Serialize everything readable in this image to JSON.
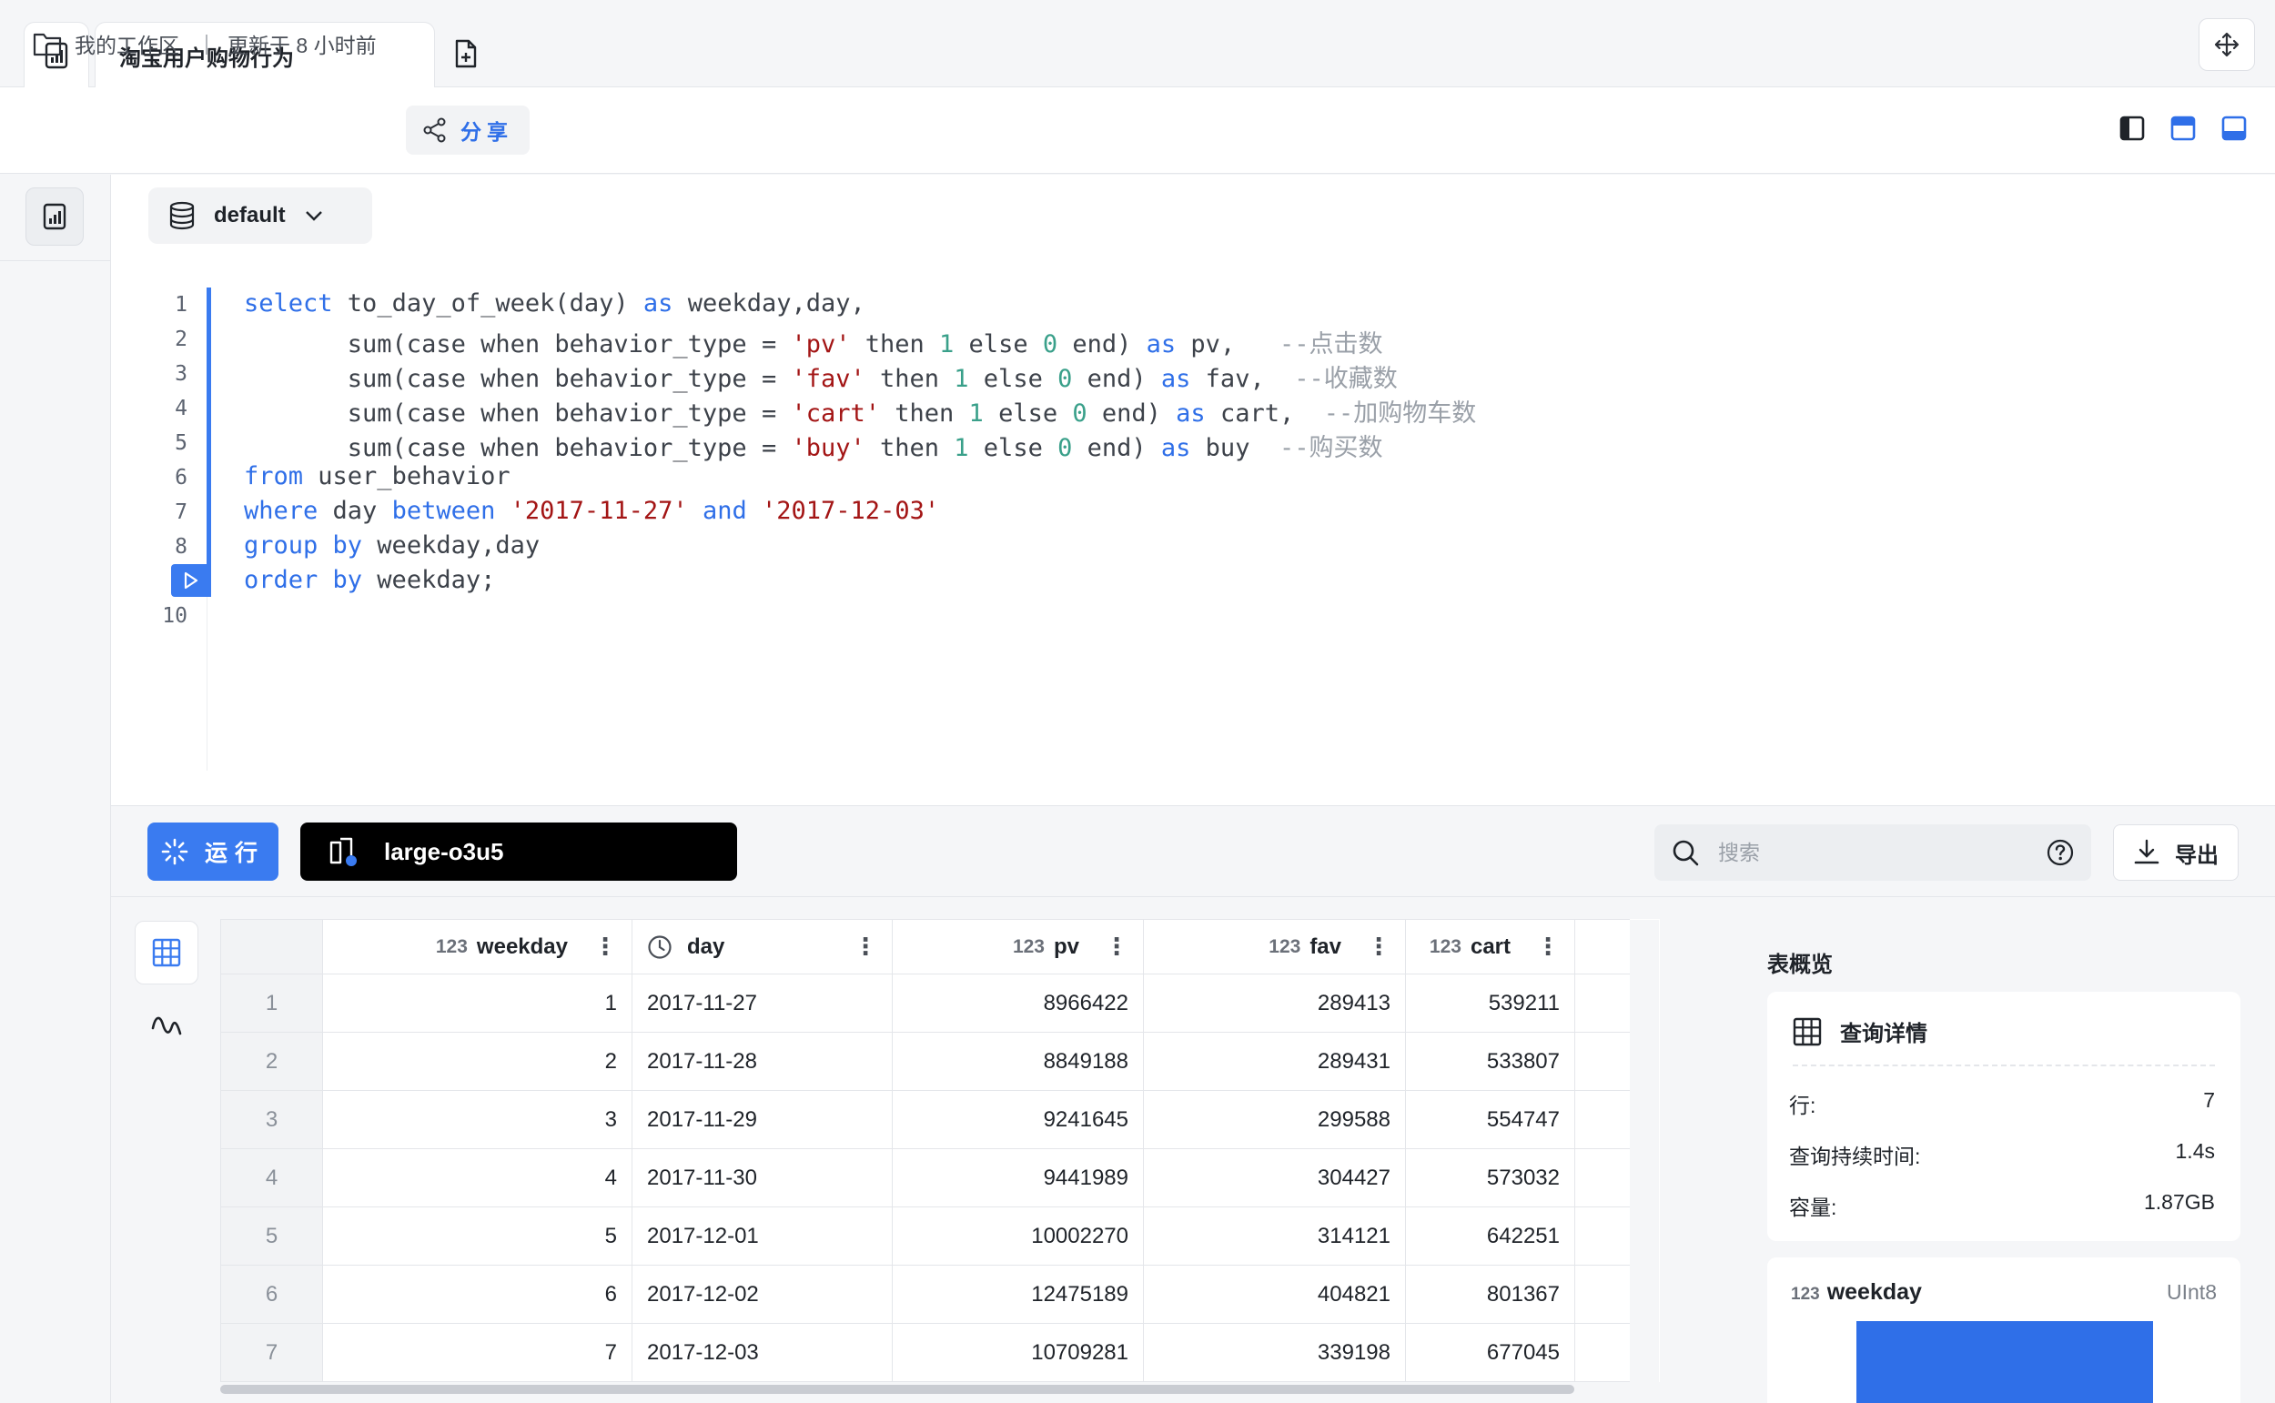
{
  "tab": {
    "title": "淘宝用户购物行为"
  },
  "breadcrumb": {
    "workspace": "我的工作区",
    "separator": "|",
    "updated": "更新于 8 小时前",
    "share_label": "分享"
  },
  "editor": {
    "database": "default",
    "line_numbers": [
      "1",
      "2",
      "3",
      "4",
      "5",
      "6",
      "7",
      "8",
      "9",
      "10"
    ]
  },
  "toolbar": {
    "run_label": "运行",
    "cluster": "large-o3u5",
    "search_placeholder": "搜索",
    "export_label": "导出"
  },
  "table": {
    "columns": [
      {
        "type": "123",
        "name": "weekday"
      },
      {
        "type": "clock",
        "name": "day"
      },
      {
        "type": "123",
        "name": "pv"
      },
      {
        "type": "123",
        "name": "fav"
      },
      {
        "type": "123",
        "name": "cart"
      }
    ],
    "rows": [
      {
        "idx": "1",
        "weekday": "1",
        "day": "2017-11-27",
        "pv": "8966422",
        "fav": "289413",
        "cart": "539211"
      },
      {
        "idx": "2",
        "weekday": "2",
        "day": "2017-11-28",
        "pv": "8849188",
        "fav": "289431",
        "cart": "533807"
      },
      {
        "idx": "3",
        "weekday": "3",
        "day": "2017-11-29",
        "pv": "9241645",
        "fav": "299588",
        "cart": "554747"
      },
      {
        "idx": "4",
        "weekday": "4",
        "day": "2017-11-30",
        "pv": "9441989",
        "fav": "304427",
        "cart": "573032"
      },
      {
        "idx": "5",
        "weekday": "5",
        "day": "2017-12-01",
        "pv": "10002270",
        "fav": "314121",
        "cart": "642251"
      },
      {
        "idx": "6",
        "weekday": "6",
        "day": "2017-12-02",
        "pv": "12475189",
        "fav": "404821",
        "cart": "801367"
      },
      {
        "idx": "7",
        "weekday": "7",
        "day": "2017-12-03",
        "pv": "10709281",
        "fav": "339198",
        "cart": "677045"
      }
    ]
  },
  "overview": {
    "title": "表概览",
    "details_title": "查询详情",
    "rows_label": "行:",
    "rows_value": "7",
    "duration_label": "查询持续时间:",
    "duration_value": "1.4s",
    "size_label": "容量:",
    "size_value": "1.87GB",
    "column_type_code": "123",
    "column_name": "weekday",
    "column_type": "UInt8"
  },
  "colors": {
    "accent": "#3a7bf0",
    "keyword": "#2f6fe8",
    "string": "#a31515",
    "number": "#3aa08a",
    "comment": "#9aa0a8"
  },
  "icons": [
    "report-icon",
    "new-file-icon",
    "move-icon",
    "folder-icon",
    "share-icon",
    "layout-left-icon",
    "layout-top-icon",
    "layout-bottom-icon",
    "database-icon",
    "chevron-down-icon",
    "play-icon",
    "spinner-icon",
    "cluster-icon",
    "search-icon",
    "help-icon",
    "download-icon",
    "table-icon",
    "chart-wave-icon",
    "clock-icon",
    "more-vertical-icon"
  ]
}
